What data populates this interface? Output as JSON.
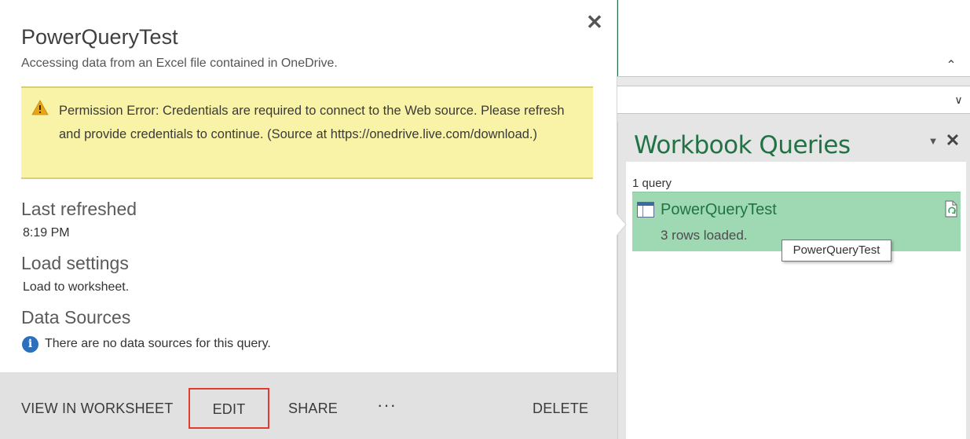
{
  "flyout": {
    "title": "PowerQueryTest",
    "subtitle": "Accessing data from an Excel file contained in OneDrive.",
    "close_icon": "close-icon",
    "warning": {
      "icon": "warning-icon",
      "text": "Permission Error: Credentials are required to connect to the Web source. Please refresh and provide credentials to continue. (Source at https://onedrive.live.com/download.)"
    },
    "last_refreshed": {
      "label": "Last refreshed",
      "value": "8:19 PM"
    },
    "load_settings": {
      "label": "Load settings",
      "value": "Load to worksheet."
    },
    "data_sources": {
      "label": "Data Sources",
      "icon": "info-icon",
      "value": "There are no data sources for this query."
    },
    "actions": {
      "view_in_worksheet": "VIEW IN WORKSHEET",
      "edit": "EDIT",
      "share": "SHARE",
      "more": "···",
      "delete": "DELETE"
    }
  },
  "workbook_queries": {
    "title": "Workbook Queries",
    "count": "1 query",
    "queries": [
      {
        "name": "PowerQueryTest",
        "status": "3 rows loaded.",
        "icon": "table-icon",
        "refresh_icon": "refresh-document-icon"
      }
    ],
    "tooltip": "PowerQueryTest"
  },
  "colors": {
    "excel_green": "#217346",
    "selected_query_bg": "#9fd9b4",
    "warning_bg": "#f8f3a7",
    "action_bar_bg": "#e1e1e1",
    "edit_highlight": "#e03c31",
    "info_blue": "#2e6fba"
  }
}
